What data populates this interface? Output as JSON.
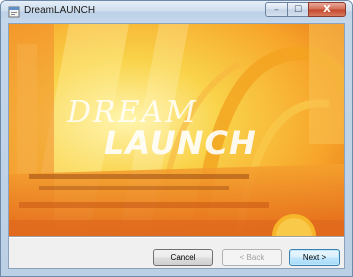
{
  "window": {
    "title": "DreamLAUNCH",
    "caption_buttons": {
      "minimize_icon": "minimize-icon",
      "maximize_icon": "maximize-icon",
      "close_icon": "close-icon",
      "minimize_glyph": "–",
      "maximize_glyph": "☐",
      "close_glyph": "X"
    }
  },
  "banner": {
    "logo_text_line1": "DREAM",
    "logo_text_line2": "LAUNCH",
    "colors": {
      "primary": "#f7a52a",
      "secondary": "#f9d34a",
      "accent": "#e85a12"
    }
  },
  "buttons": {
    "cancel": "Cancel",
    "back": "< Back",
    "next": "Next >"
  }
}
